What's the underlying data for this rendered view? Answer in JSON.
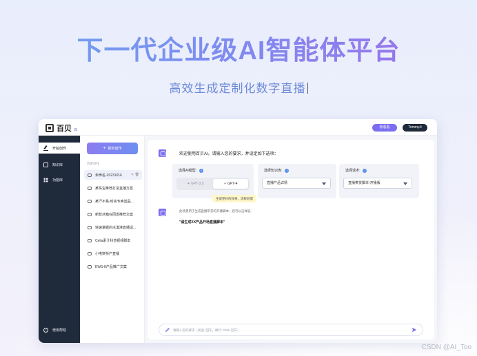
{
  "hero": {
    "title": "下一代企业级AI智能体平台",
    "subtitle": "高效生成定制化数字直播"
  },
  "topbar": {
    "logo_text": "百贝",
    "logo_suffix": "ai",
    "action_label": "去看看",
    "user_label": "Tommy.li"
  },
  "sidebar": {
    "items": [
      {
        "label": "开始创作",
        "icon": "edit-icon"
      },
      {
        "label": "知识库",
        "icon": "book-icon"
      },
      {
        "label": "功能库",
        "icon": "grid-icon"
      }
    ],
    "help_label": "使用帮助"
  },
  "history": {
    "new_label": "新的创作",
    "section_label": "历史创作",
    "items": [
      "未命名-20231016",
      "某珠宝推荐打造直播方案",
      "某汗不易-时尚专卖送品...",
      "新款冰箱在团发推荐文案",
      "快速掌握的冰淇淋直播话...",
      "Celia素汁科普视频脚本",
      "小电饼桥产直播",
      "EWS-8产品推广文案"
    ]
  },
  "chat": {
    "welcome": "欢迎使用百贝AI。请输入您的要求，并设定如下选项：",
    "model": {
      "title": "选择AI模型:",
      "options": [
        "GPT-3.5",
        "GPT-4"
      ],
      "selected": "GPT-4"
    },
    "knowledge": {
      "title": "选择知识库:",
      "value": "直播产品详情"
    },
    "template": {
      "title": "选择话术:",
      "value": "直播带货脚本-开播版"
    },
    "tooltip": "生成更好的效果，消耗较慢",
    "hint": "此场景用于生成直播带货的开播脚本，您可以这样说:",
    "example": "\"请生成XX产品开场直播脚本\"",
    "input_placeholder": "请输入您的要求（发送: 回车，换行: Shift+回车）"
  },
  "watermark": "CSDN @AI_Too",
  "colors": {
    "accent": "#7b6ef0",
    "sidebar_bg": "#1f2a3a",
    "tooltip_bg": "#fff7c8"
  }
}
